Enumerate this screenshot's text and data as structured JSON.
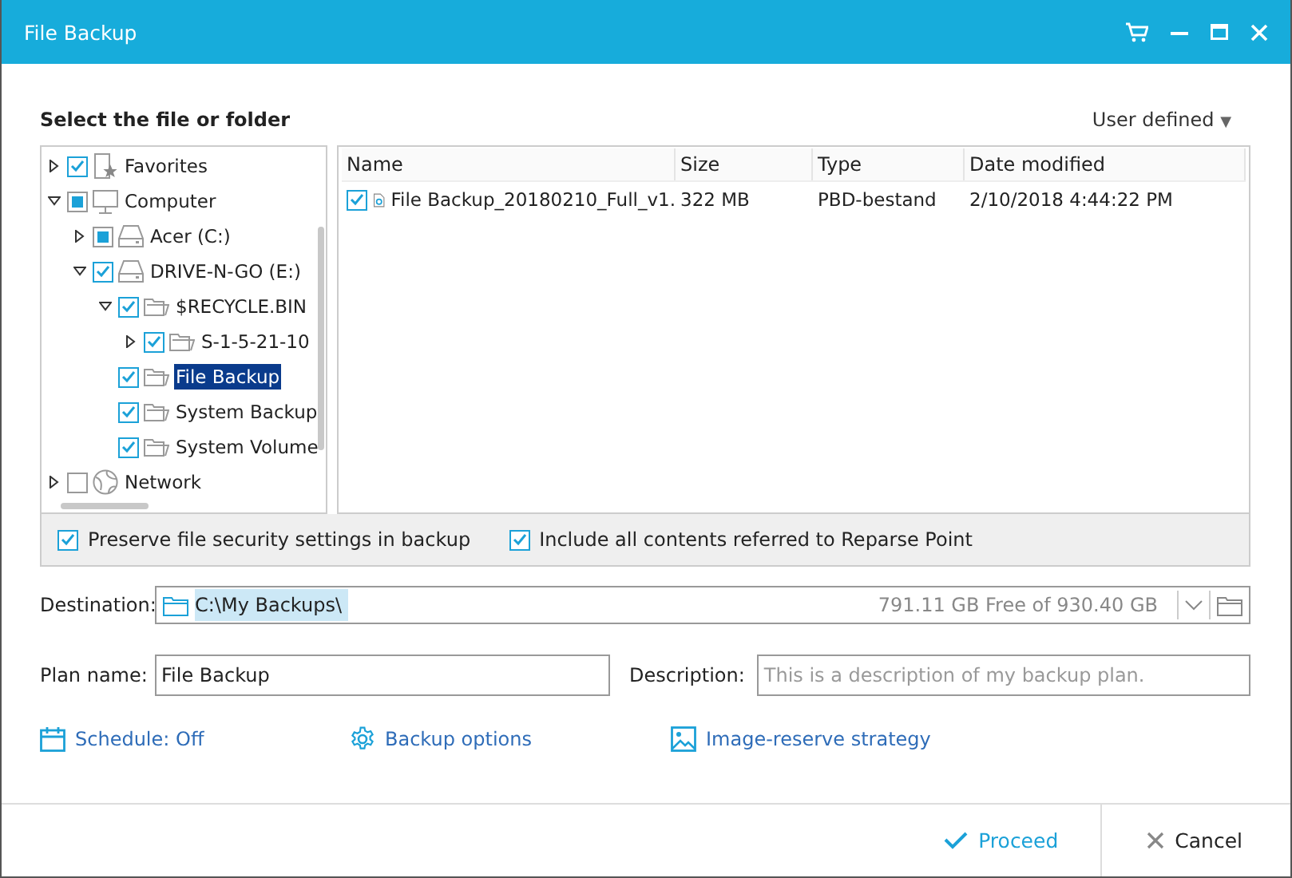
{
  "window": {
    "title": "File Backup"
  },
  "heading": "Select the file or folder",
  "filter": {
    "label": "User defined",
    "caret": "▼"
  },
  "tree": [
    {
      "label": "Favorites",
      "kind": "favorites",
      "checked": true,
      "partial": false,
      "expanded": false,
      "selected": false
    },
    {
      "label": "Computer",
      "kind": "computer",
      "checked": false,
      "partial": true,
      "expanded": true,
      "selected": false,
      "children": [
        {
          "label": "Acer (C:)",
          "kind": "drive",
          "checked": false,
          "partial": true,
          "expanded": false,
          "selected": false
        },
        {
          "label": "DRIVE-N-GO (E:)",
          "kind": "drive",
          "checked": true,
          "partial": false,
          "expanded": true,
          "selected": false,
          "children": [
            {
              "label": "$RECYCLE.BIN",
              "kind": "folder",
              "checked": true,
              "partial": false,
              "expanded": true,
              "selected": false,
              "children": [
                {
                  "label": "S-1-5-21-10",
                  "kind": "folder",
                  "checked": true,
                  "partial": false,
                  "expanded": false,
                  "selected": false
                }
              ]
            },
            {
              "label": "File Backup",
              "kind": "folder",
              "checked": true,
              "partial": false,
              "selected": true
            },
            {
              "label": "System Backup",
              "kind": "folder",
              "checked": true,
              "partial": false,
              "selected": false
            },
            {
              "label": "System Volume",
              "kind": "folder",
              "checked": true,
              "partial": false,
              "selected": false
            }
          ]
        }
      ]
    },
    {
      "label": "Network",
      "kind": "network",
      "checked": false,
      "partial": false,
      "expanded": false,
      "selected": false
    }
  ],
  "files": {
    "columns": [
      "Name",
      "Size",
      "Type",
      "Date modified"
    ],
    "rows": [
      {
        "checked": true,
        "cells": [
          "File Backup_20180210_Full_v1.",
          "322 MB",
          "PBD-bestand",
          "2/10/2018 4:44:22  PM"
        ]
      }
    ]
  },
  "options": [
    {
      "label": "Preserve file security settings in backup",
      "checked": true
    },
    {
      "label": "Include all contents referred to Reparse Point",
      "checked": true
    }
  ],
  "destination": {
    "label": "Destination:",
    "value": "C:\\My Backups\\",
    "space": "791.11 GB Free of 930.40 GB"
  },
  "plan_name": {
    "label": "Plan name:",
    "value": "File Backup"
  },
  "description": {
    "label": "Description:",
    "placeholder": "This is a description of my backup plan."
  },
  "links": [
    {
      "kind": "schedule",
      "label": "Schedule: Off"
    },
    {
      "kind": "options",
      "label": "Backup options"
    },
    {
      "kind": "image",
      "label": "Image-reserve strategy"
    }
  ],
  "buttons": [
    {
      "kind": "proceed",
      "label": "Proceed"
    },
    {
      "kind": "cancel",
      "label": "Cancel"
    }
  ]
}
